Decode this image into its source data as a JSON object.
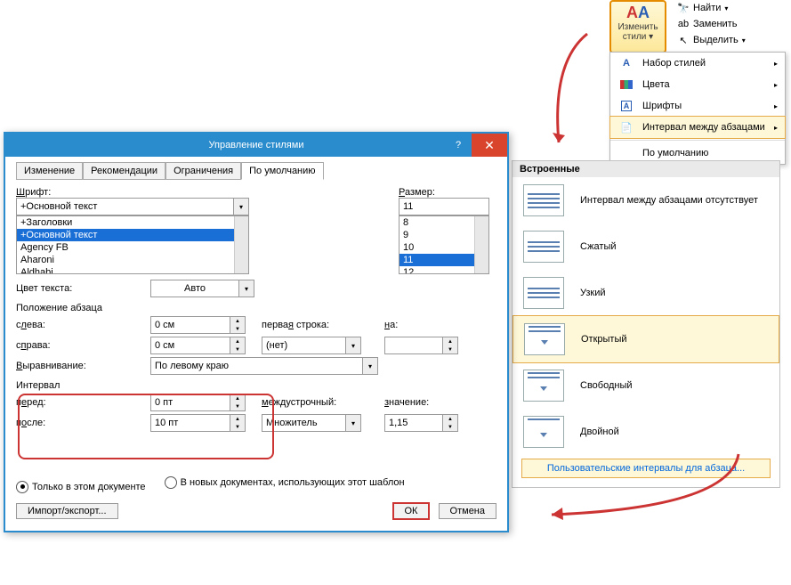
{
  "ribbon": {
    "change_styles": {
      "line1": "Изменить",
      "line2": "стили"
    },
    "find": "Найти",
    "replace": "Заменить",
    "select": "Выделить"
  },
  "menu": {
    "style_set": "Набор стилей",
    "colors": "Цвета",
    "fonts": "Шрифты",
    "para_spacing": "Интервал между абзацами",
    "default": "По умолчанию"
  },
  "panel": {
    "header": "Встроенные",
    "items": [
      "Интервал между абзацами отсутствует",
      "Сжатый",
      "Узкий",
      "Открытый",
      "Свободный",
      "Двойной"
    ],
    "custom": "Пользовательские интервалы для абзаца..."
  },
  "dialog": {
    "title": "Управление стилями",
    "tabs": [
      "Изменение",
      "Рекомендации",
      "Ограничения",
      "По умолчанию"
    ],
    "font_label": "Шрифт:",
    "font_value": "+Основной текст",
    "font_list": [
      "+Заголовки",
      "+Основной текст",
      "Agency FB",
      "Aharoni",
      "Aldhabi"
    ],
    "size_label": "Размер:",
    "size_value": "11",
    "size_list": [
      "8",
      "9",
      "10",
      "11",
      "12"
    ],
    "textcolor_label": "Цвет текста:",
    "textcolor_value": "Авто",
    "position_label": "Положение абзаца",
    "left_label": "слева:",
    "left_value": "0 см",
    "right_label": "справа:",
    "right_value": "0 см",
    "align_label": "Выравнивание:",
    "align_value": "По левому краю",
    "firstline_label": "первая строка:",
    "firstline_value": "(нет)",
    "by_label": "на:",
    "interval_label": "Интервал",
    "before_label": "перед:",
    "before_value": "0 пт",
    "after_label": "после:",
    "after_value": "10 пт",
    "linespacing_label": "междустрочный:",
    "linespacing_value": "Множитель",
    "value_label": "значение:",
    "value_value": "1,15",
    "radio_doc": "Только в этом документе",
    "radio_templ": "В новых документах, использующих этот шаблон",
    "import": "Импорт/экспорт...",
    "ok": "ОК",
    "cancel": "Отмена"
  }
}
